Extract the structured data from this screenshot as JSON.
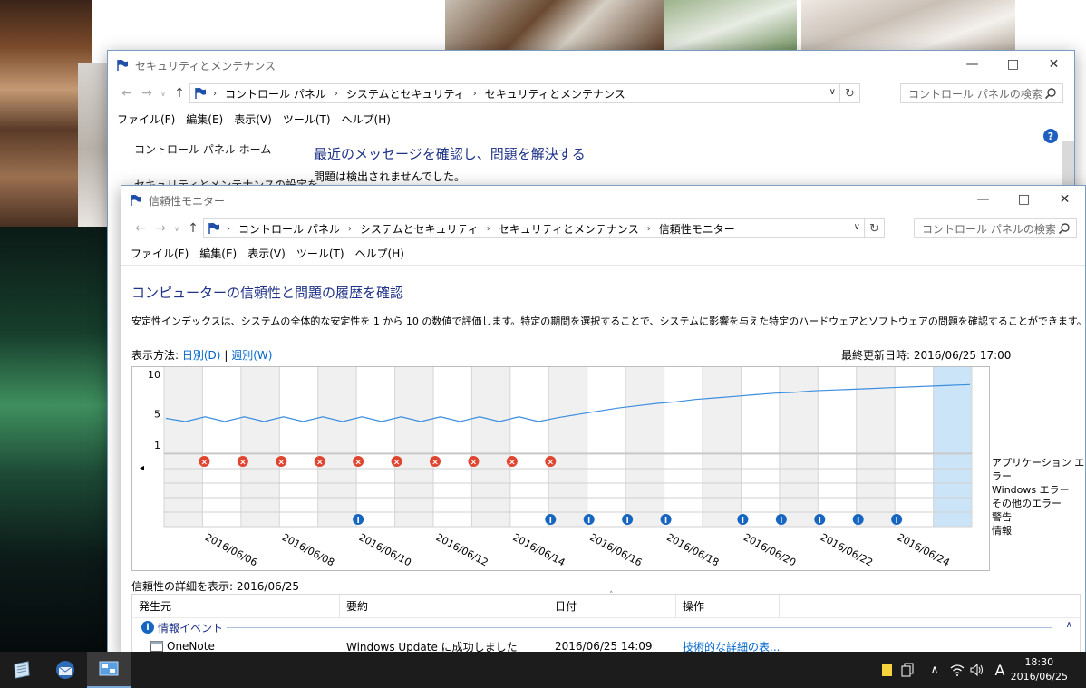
{
  "colors": {
    "link": "#0066cc",
    "heading": "#1e3287",
    "chart_line": "#3d8ee0",
    "error_icon": "#e0452f",
    "info_icon": "#1665c0",
    "selected_day": "#cce4f7",
    "taskbar": "#1c1c1c"
  },
  "back_window": {
    "title": "セキュリティとメンテナンス",
    "breadcrumbs": [
      "コントロール パネル",
      "システムとセキュリティ",
      "セキュリティとメンテナンス"
    ],
    "search_placeholder": "コントロール パネルの検索",
    "menu": [
      "ファイル(F)",
      "編集(E)",
      "表示(V)",
      "ツール(T)",
      "ヘルプ(H)"
    ],
    "left_links": [
      "コントロール パネル ホーム",
      "セキュリティとメンテナンスの設定を"
    ],
    "heading": "最近のメッセージを確認し、問題を解決する",
    "status": "問題は検出されませんでした。",
    "help_glyph": "?"
  },
  "front_window": {
    "title": "信頼性モニター",
    "breadcrumbs": [
      "コントロール パネル",
      "システムとセキュリティ",
      "セキュリティとメンテナンス",
      "信頼性モニター"
    ],
    "search_placeholder": "コントロール パネルの検索",
    "menu": [
      "ファイル(F)",
      "編集(E)",
      "表示(V)",
      "ツール(T)",
      "ヘルプ(H)"
    ],
    "heading": "コンピューターの信頼性と問題の履歴を確認",
    "description": "安定性インデックスは、システムの全体的な安定性を 1 から 10 の数値で評価します。特定の期間を選択することで、システムに影響を与えた特定のハードウェアとソフトウェアの問題を確認することができます。",
    "view_by_label": "表示方法:",
    "view_daily": "日別(D)",
    "view_separator": "|",
    "view_weekly": "週別(W)",
    "last_updated": "最終更新日時: 2016/06/25 17:00",
    "detail_label": "信頼性の詳細を表示: 2016/06/25",
    "legend": [
      "アプリケーション エラー",
      "Windows エラー",
      "その他のエラー",
      "警告",
      "情報"
    ],
    "table": {
      "columns": [
        "発生元",
        "要約",
        "日付",
        "操作"
      ],
      "group": "情報イベント",
      "rows": [
        {
          "source": "OneNote",
          "summary": "Windows Update に成功しました",
          "date": "2016/06/25 14:09",
          "action": "技術的な詳細の表..."
        }
      ]
    }
  },
  "chart_data": {
    "type": "line",
    "title": "",
    "yticks": [
      "10",
      "5",
      "1"
    ],
    "ylim": [
      1,
      10
    ],
    "selected_index": 20,
    "x": [
      "2016/06/05",
      "2016/06/06",
      "2016/06/07",
      "2016/06/08",
      "2016/06/09",
      "2016/06/10",
      "2016/06/11",
      "2016/06/12",
      "2016/06/13",
      "2016/06/14",
      "2016/06/15",
      "2016/06/16",
      "2016/06/17",
      "2016/06/18",
      "2016/06/19",
      "2016/06/20",
      "2016/06/21",
      "2016/06/22",
      "2016/06/23",
      "2016/06/24",
      "2016/06/25"
    ],
    "x_tick_labels": [
      "2016/06/06",
      "2016/06/08",
      "2016/06/10",
      "2016/06/12",
      "2016/06/14",
      "2016/06/16",
      "2016/06/18",
      "2016/06/20",
      "2016/06/22",
      "2016/06/24"
    ],
    "x_tick_indices": [
      1,
      3,
      5,
      7,
      9,
      11,
      13,
      15,
      17,
      19
    ],
    "series": [
      {
        "values": [
          4.4,
          4.0,
          4.6,
          4.0,
          4.6,
          4.0,
          4.6,
          4.0,
          4.6,
          4.0,
          4.6,
          4.0,
          4.6,
          4.0,
          4.6,
          4.0,
          4.6,
          4.0,
          4.6,
          4.0,
          4.5,
          4.9,
          5.3,
          5.7,
          6.0,
          6.3,
          6.5,
          6.8,
          7.0,
          7.2,
          7.4,
          7.6,
          7.7,
          7.9,
          8.0,
          8.1,
          8.2,
          8.3,
          8.4,
          8.5,
          8.6,
          8.7
        ]
      }
    ],
    "events": {
      "application_error_indices": [
        1,
        2,
        3,
        4,
        5,
        6,
        7,
        8,
        9,
        10
      ],
      "information_indices": [
        5,
        10,
        11,
        12,
        13,
        15,
        16,
        17,
        18,
        19
      ]
    }
  },
  "taskbar": {
    "ime": "A",
    "time": "18:30",
    "date": "2016/06/25"
  }
}
